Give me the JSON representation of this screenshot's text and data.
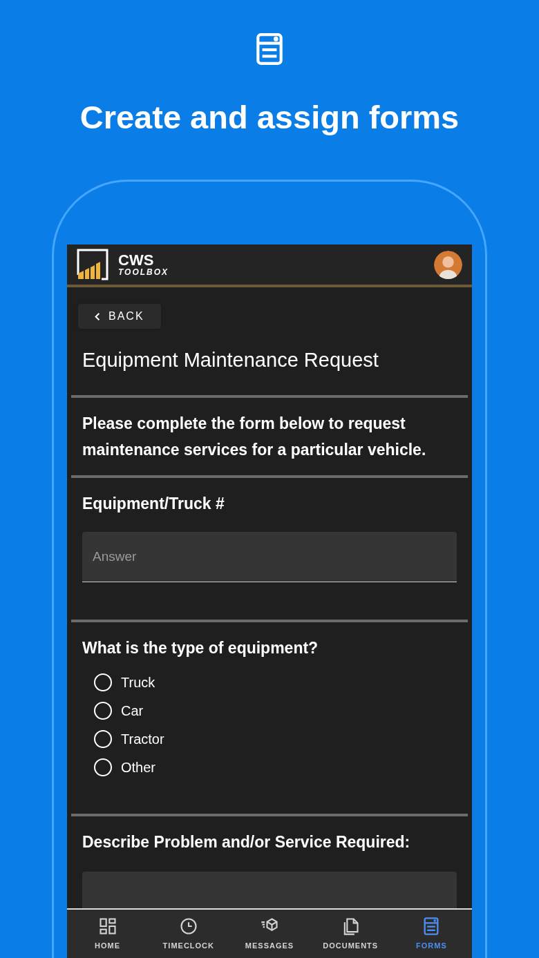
{
  "headline": "Create and assign forms",
  "app_header": {
    "logo_line_1": "CWS",
    "logo_line_2": "TOOLBOX"
  },
  "back_button": {
    "label": "BACK"
  },
  "form_title": "Equipment Maintenance Request",
  "description": "Please complete the form below to request maintenance services for a particular vehicle.",
  "questions": [
    {
      "kind": "text",
      "label": "Equipment/Truck #",
      "placeholder": "Answer"
    },
    {
      "kind": "choice",
      "label": "What is the type of equipment?",
      "options": [
        {
          "label": "Truck",
          "selected": false
        },
        {
          "label": "Car",
          "selected": false
        },
        {
          "label": "Tractor",
          "selected": false
        },
        {
          "label": "Other",
          "selected": false
        }
      ]
    },
    {
      "kind": "textarea",
      "label": "Describe Problem and/or Service Required:"
    }
  ],
  "bottom_nav": [
    {
      "kind": "home",
      "label": "HOME",
      "selected": false
    },
    {
      "kind": "timeclock",
      "label": "TIMECLOCK",
      "selected": false
    },
    {
      "kind": "messages",
      "label": "MESSAGES",
      "selected": false
    },
    {
      "kind": "documents",
      "label": "DOCUMENTS",
      "selected": false
    },
    {
      "kind": "forms",
      "label": "FORMS",
      "selected": true
    }
  ]
}
